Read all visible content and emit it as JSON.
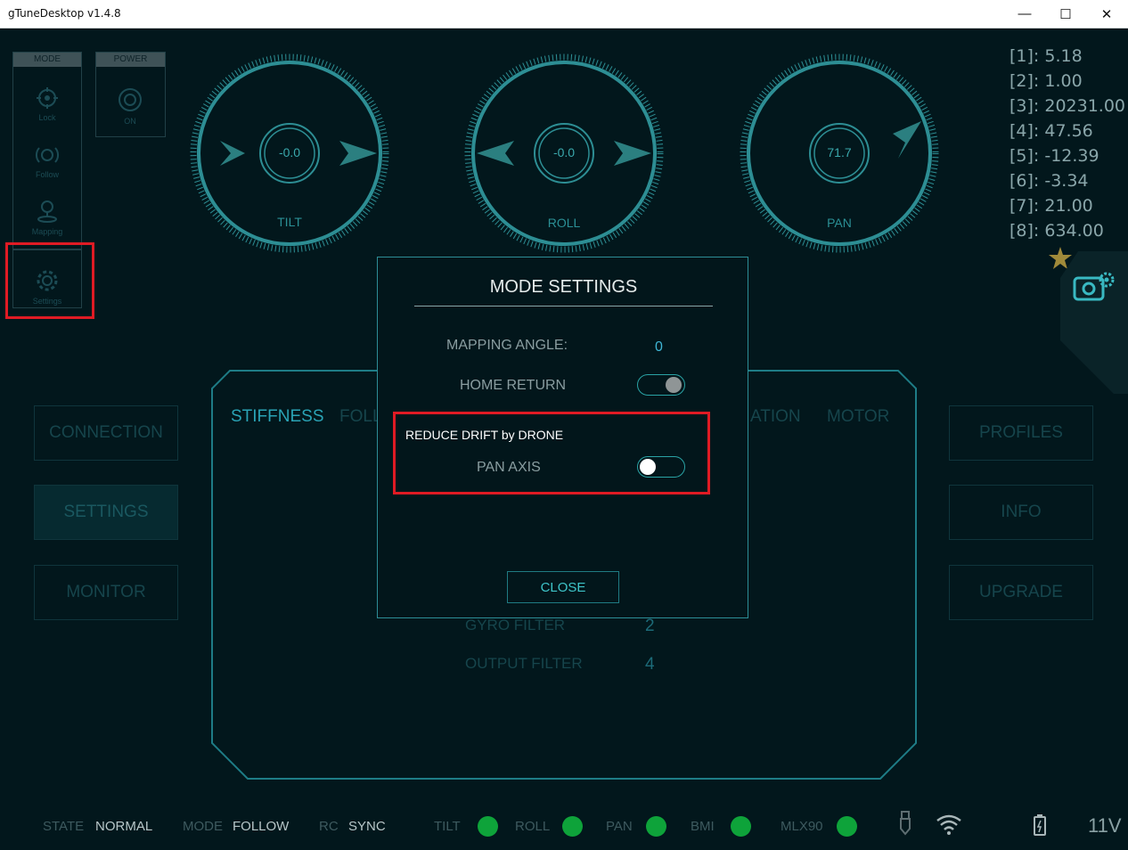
{
  "window": {
    "title": "gTuneDesktop  v1.4.8",
    "controls": [
      "minimize-icon",
      "maximize-icon",
      "close-icon"
    ]
  },
  "mode_panel": {
    "header": "MODE",
    "items": [
      {
        "label": "Lock",
        "icon": "crosshair-icon"
      },
      {
        "label": "Follow",
        "icon": "follow-icon"
      },
      {
        "label": "Mapping",
        "icon": "map-pin-icon"
      },
      {
        "label": "Settings",
        "icon": "gear-icon"
      }
    ]
  },
  "power_panel": {
    "header": "POWER",
    "item": {
      "label": "ON",
      "icon": "power-icon"
    }
  },
  "dials": [
    {
      "name": "TILT",
      "value": "-0.0"
    },
    {
      "name": "ROLL",
      "value": "-0.0"
    },
    {
      "name": "PAN",
      "value": "71.7"
    }
  ],
  "readouts": [
    "[1]: 5.18",
    "[2]: 1.00",
    "[3]: 20231.00",
    "[4]: 47.56",
    "[5]: -12.39",
    "[6]: -3.34",
    "[7]: 21.00",
    "[8]: 634.00"
  ],
  "left_buttons": [
    "CONNECTION",
    "SETTINGS",
    "MONITOR"
  ],
  "right_buttons": [
    "PROFILES",
    "INFO",
    "UPGRADE"
  ],
  "tabs": [
    "STIFFNESS",
    "FOLL",
    "ATION",
    "MOTOR"
  ],
  "background_rows": [
    {
      "label": "GYRO FILTER",
      "value": "2"
    },
    {
      "label": "OUTPUT FILTER",
      "value": "4"
    }
  ],
  "modal": {
    "title": "MODE SETTINGS",
    "mapping_angle_label": "MAPPING ANGLE:",
    "mapping_angle_value": "0",
    "home_return_label": "HOME RETURN",
    "home_return_on": true,
    "reduce_drift_heading": "REDUCE DRIFT by DRONE",
    "pan_axis_label": "PAN AXIS",
    "pan_axis_on": false,
    "close_label": "CLOSE"
  },
  "status_bar": {
    "state_label": "STATE",
    "state_value": "NORMAL",
    "mode_label": "MODE",
    "mode_value": "FOLLOW",
    "rc_label": "RC",
    "rc_value": "SYNC",
    "indicators": [
      {
        "label": "TILT",
        "color": "#0ea33a"
      },
      {
        "label": "ROLL",
        "color": "#0ea33a"
      },
      {
        "label": "PAN",
        "color": "#0ea33a"
      },
      {
        "label": "BMI",
        "color": "#0ea33a"
      },
      {
        "label": "MLX90",
        "color": "#0ea33a"
      }
    ],
    "voltage": "11V"
  },
  "colors": {
    "accent": "#2aa3a5",
    "highlight": "#e01b24",
    "ok": "#0ea33a"
  }
}
